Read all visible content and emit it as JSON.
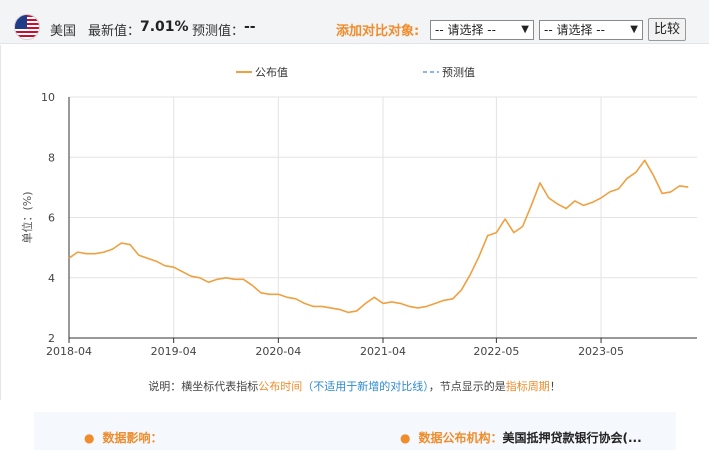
{
  "header": {
    "flag_icon": "us-flag-icon",
    "country": "美国",
    "latest_label": "最新值：",
    "latest_value": "7.01%",
    "forecast_label": "预测值：",
    "forecast_value": "--",
    "compare_label": "添加对比对象:",
    "select1_value": "-- 请选择 --",
    "select2_value": "-- 请选择 --",
    "compare_button": "比较"
  },
  "note": {
    "part1": "说明：横坐标代表指标",
    "part2": "公布时间",
    "part3": "（不适用于新增的对比线）",
    "part4": "，节点显示的是",
    "part5": "指标周期",
    "part6": "！"
  },
  "info": {
    "impact_label": "数据影响：",
    "impact_value": "",
    "agency_label": "数据公布机构：",
    "agency_value": "美国抵押贷款银行协会(..."
  },
  "chart_data": {
    "type": "line",
    "title": "",
    "xlabel": "",
    "ylabel": "单位：(%)",
    "ylim": [
      2,
      10
    ],
    "yticks": [
      2,
      4,
      6,
      8,
      10
    ],
    "xlim": [
      "2018-04",
      "2024-04"
    ],
    "xticks": [
      "2018-04",
      "2019-04",
      "2020-04",
      "2021-04",
      "2022-05",
      "2023-05"
    ],
    "grid": true,
    "legend_position": "top-center",
    "colors": {
      "published": "#f0a040",
      "forecast": "#8cb8e0",
      "axis": "#333333",
      "grid": "#e3e3e3"
    },
    "series": [
      {
        "name": "公布值",
        "style": "solid",
        "x": [
          "2018-04",
          "2018-05",
          "2018-06",
          "2018-07",
          "2018-08",
          "2018-09",
          "2018-10",
          "2018-11",
          "2018-12",
          "2019-01",
          "2019-02",
          "2019-03",
          "2019-04",
          "2019-05",
          "2019-06",
          "2019-07",
          "2019-08",
          "2019-09",
          "2019-10",
          "2019-11",
          "2019-12",
          "2020-01",
          "2020-02",
          "2020-03",
          "2020-04",
          "2020-05",
          "2020-06",
          "2020-07",
          "2020-08",
          "2020-09",
          "2020-10",
          "2020-11",
          "2020-12",
          "2021-01",
          "2021-02",
          "2021-03",
          "2021-04",
          "2021-05",
          "2021-06",
          "2021-07",
          "2021-08",
          "2021-09",
          "2021-10",
          "2021-11",
          "2021-12",
          "2022-01",
          "2022-02",
          "2022-03",
          "2022-04",
          "2022-05",
          "2022-06",
          "2022-07",
          "2022-08",
          "2022-09",
          "2022-10",
          "2022-11",
          "2022-12",
          "2023-01",
          "2023-02",
          "2023-03",
          "2023-04",
          "2023-05",
          "2023-06",
          "2023-07",
          "2023-08",
          "2023-09",
          "2023-10",
          "2023-11",
          "2023-12",
          "2024-01",
          "2024-02",
          "2024-03"
        ],
        "values": [
          4.65,
          4.85,
          4.8,
          4.8,
          4.85,
          4.95,
          5.15,
          5.1,
          4.75,
          4.65,
          4.55,
          4.4,
          4.35,
          4.2,
          4.05,
          4.0,
          3.85,
          3.95,
          4.0,
          3.95,
          3.95,
          3.75,
          3.5,
          3.45,
          3.45,
          3.35,
          3.3,
          3.15,
          3.05,
          3.05,
          3.0,
          2.95,
          2.85,
          2.9,
          3.15,
          3.35,
          3.15,
          3.2,
          3.15,
          3.05,
          3.0,
          3.05,
          3.15,
          3.25,
          3.3,
          3.6,
          4.1,
          4.7,
          5.4,
          5.5,
          5.95,
          5.5,
          5.7,
          6.4,
          7.15,
          6.65,
          6.45,
          6.3,
          6.55,
          6.4,
          6.5,
          6.65,
          6.85,
          6.95,
          7.3,
          7.5,
          7.9,
          7.4,
          6.8,
          6.85,
          7.05,
          7.01
        ]
      },
      {
        "name": "预测值",
        "style": "dashed",
        "x": [],
        "values": []
      }
    ]
  }
}
